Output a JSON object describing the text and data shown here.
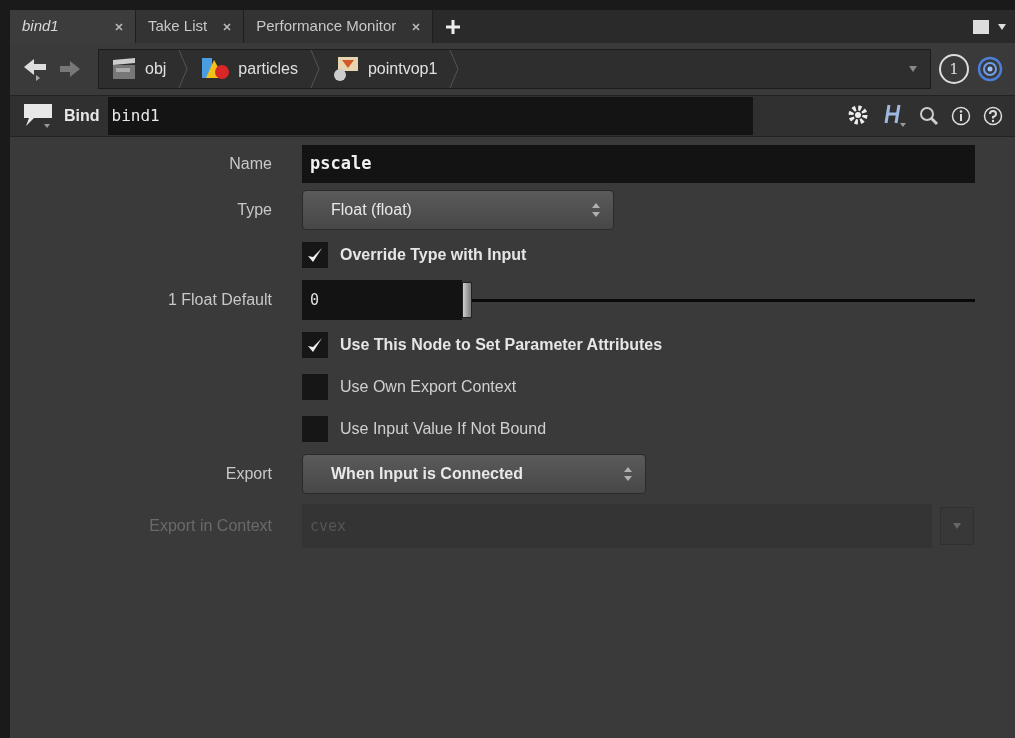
{
  "tabs": [
    {
      "label": "bind1",
      "selected": true
    },
    {
      "label": "Take List",
      "selected": false
    },
    {
      "label": "Performance Monitor",
      "selected": false
    }
  ],
  "path": [
    "obj",
    "particles",
    "pointvop1"
  ],
  "badge": "1",
  "node": {
    "type": "Bind",
    "name": "bind1"
  },
  "params": [
    {
      "kind": "text",
      "label": "Name",
      "value": "pscale"
    },
    {
      "kind": "menu",
      "label": "Type",
      "value": "Float (float)"
    },
    {
      "kind": "checkbox",
      "text": "Override Type with Input",
      "checked": true
    },
    {
      "kind": "slider",
      "label": "1 Float Default",
      "value": "0",
      "level": 0
    },
    {
      "kind": "checkbox",
      "text": "Use This Node to Set Parameter Attributes",
      "checked": true
    },
    {
      "kind": "checkbox",
      "text": "Use Own Export Context",
      "checked": false
    },
    {
      "kind": "checkbox",
      "text": "Use Input Value If Not Bound",
      "checked": false
    },
    {
      "kind": "menu_bold",
      "label": "Export",
      "value": "When Input is Connected"
    },
    {
      "kind": "disabled_field",
      "label": "Export in Context",
      "value": "cvex"
    }
  ]
}
